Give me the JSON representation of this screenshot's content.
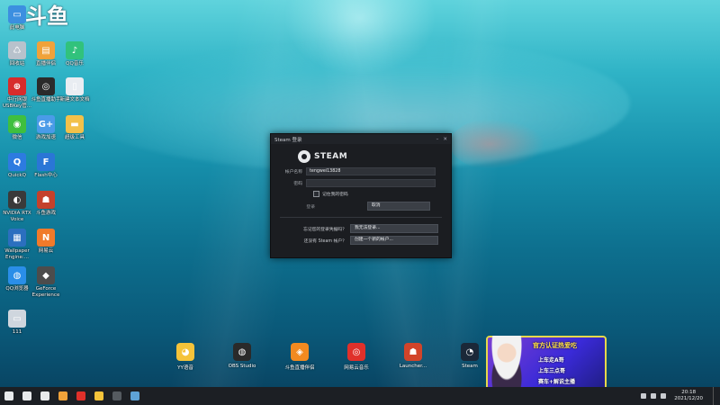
{
  "logo_text": "斗鱼",
  "desktop_icons": [
    {
      "id": "computer",
      "label": "此电脑",
      "icon": "computer-icon",
      "color": "#3c8fe0",
      "glyph": "▭"
    },
    {
      "id": "recycle",
      "label": "回收站",
      "icon": "recycle-bin-icon",
      "color": "#b8c2cc",
      "glyph": "♺"
    },
    {
      "id": "douyu-tool",
      "label": "直播伴侣",
      "icon": "douyu-tool-icon",
      "color": "#f0a23a",
      "glyph": "▤"
    },
    {
      "id": "qq-music",
      "label": "QQ音乐",
      "icon": "qq-music-icon",
      "color": "#31c27c",
      "glyph": "♪"
    },
    {
      "id": "usbkey",
      "label": "中行网银\nUSBKey管...",
      "icon": "usbkey-icon",
      "color": "#d72c2c",
      "glyph": "⊕"
    },
    {
      "id": "assistant",
      "label": "斗鱼直播助手",
      "icon": "assistant-icon",
      "color": "#2b2b2b",
      "glyph": "◎"
    },
    {
      "id": "newtext",
      "label": "新建文本文档",
      "icon": "text-file-icon",
      "color": "#e9edf2",
      "glyph": "▯"
    },
    {
      "id": "wechat",
      "label": "微信",
      "icon": "wechat-icon",
      "color": "#3fbf3f",
      "glyph": "◉"
    },
    {
      "id": "gameplus",
      "label": "游戏加速",
      "icon": "game-plus-icon",
      "color": "#4a9be8",
      "glyph": "G+"
    },
    {
      "id": "folder",
      "label": "超级工具",
      "icon": "folder-icon",
      "color": "#f2c14a",
      "glyph": "▬"
    },
    {
      "id": "quickq",
      "label": "QuickQ",
      "icon": "quickq-icon",
      "color": "#2d7be0",
      "glyph": "Q"
    },
    {
      "id": "flash",
      "label": "Flash中心",
      "icon": "flash-icon",
      "color": "#2a76d6",
      "glyph": "F"
    },
    {
      "id": "nvidia",
      "label": "NVIDIA RTX\nVoice",
      "icon": "nvidia-icon",
      "color": "#3a3a3a",
      "glyph": "◐"
    },
    {
      "id": "game",
      "label": "斗鱼游戏",
      "icon": "game-icon",
      "color": "#c4412c",
      "glyph": "☗"
    },
    {
      "id": "wallpaper",
      "label": "Wallpaper\nEngine:...",
      "icon": "wallpaper-engine-icon",
      "color": "#2b6fbf",
      "glyph": "▦"
    },
    {
      "id": "sketch",
      "label": "网易云",
      "icon": "sketch-icon",
      "color": "#f07a2a",
      "glyph": "N"
    },
    {
      "id": "qqbrowser",
      "label": "QQ浏览器",
      "icon": "qq-browser-icon",
      "color": "#2a8ee8",
      "glyph": "◍"
    },
    {
      "id": "geforce",
      "label": "GeForce\nExperience",
      "icon": "geforce-icon",
      "color": "#4c4c4c",
      "glyph": "◆"
    },
    {
      "id": "unknown",
      "label": "111",
      "icon": "generic-app-icon",
      "color": "#cfd6de",
      "glyph": "▭"
    }
  ],
  "dock": [
    {
      "label": "YY语音",
      "icon": "yy-icon",
      "color": "#f5c33a",
      "glyph": "◕"
    },
    {
      "label": "OBS Studio",
      "icon": "obs-icon",
      "color": "#2a2a2a",
      "glyph": "◍"
    },
    {
      "label": "斗鱼直播伴侣",
      "icon": "douyu-companion-icon",
      "color": "#f28a20",
      "glyph": "◈"
    },
    {
      "label": "网易云音乐",
      "icon": "netease-music-icon",
      "color": "#e0302a",
      "glyph": "◎"
    },
    {
      "label": "Launcher...",
      "icon": "launcher-icon",
      "color": "#d2442a",
      "glyph": "☗"
    },
    {
      "label": "Steam",
      "icon": "steam-icon",
      "color": "#1b2838",
      "glyph": "◔"
    }
  ],
  "steam_login": {
    "window_title": "Steam 登录",
    "brand": "STEAM",
    "username_label": "帐户名称",
    "username_value": "tengwei13828",
    "password_label": "密码",
    "password_value": "",
    "remember_label": "记住我的密码",
    "login_button": "登录",
    "cancel_button": "取消",
    "forgot_question": "忘记您的登录凭据吗？",
    "forgot_button": "我无法登录...",
    "create_question": "还没有 Steam 帐户？",
    "create_button": "创建一个新的帐户..."
  },
  "promo": {
    "title": "官方认证热爱吃",
    "lines": [
      "上车走A哥",
      "上车三点哥",
      "赛车+解说主播"
    ]
  },
  "taskbar": {
    "time": "20:18",
    "date": "2021/12/20",
    "items": [
      {
        "icon": "windows-start-icon",
        "color": "#e8eaec"
      },
      {
        "icon": "search-icon",
        "color": "#e8eaec"
      },
      {
        "icon": "task-view-icon",
        "color": "#e8eaec"
      },
      {
        "icon": "douyu-taskbar-icon",
        "color": "#f0a23a"
      },
      {
        "icon": "netease-taskbar-icon",
        "color": "#e0302a"
      },
      {
        "icon": "yy-taskbar-icon",
        "color": "#f5c33a"
      },
      {
        "icon": "obs-taskbar-icon",
        "color": "#555a60"
      },
      {
        "icon": "steam-taskbar-icon",
        "color": "#5ea2d6"
      }
    ]
  }
}
